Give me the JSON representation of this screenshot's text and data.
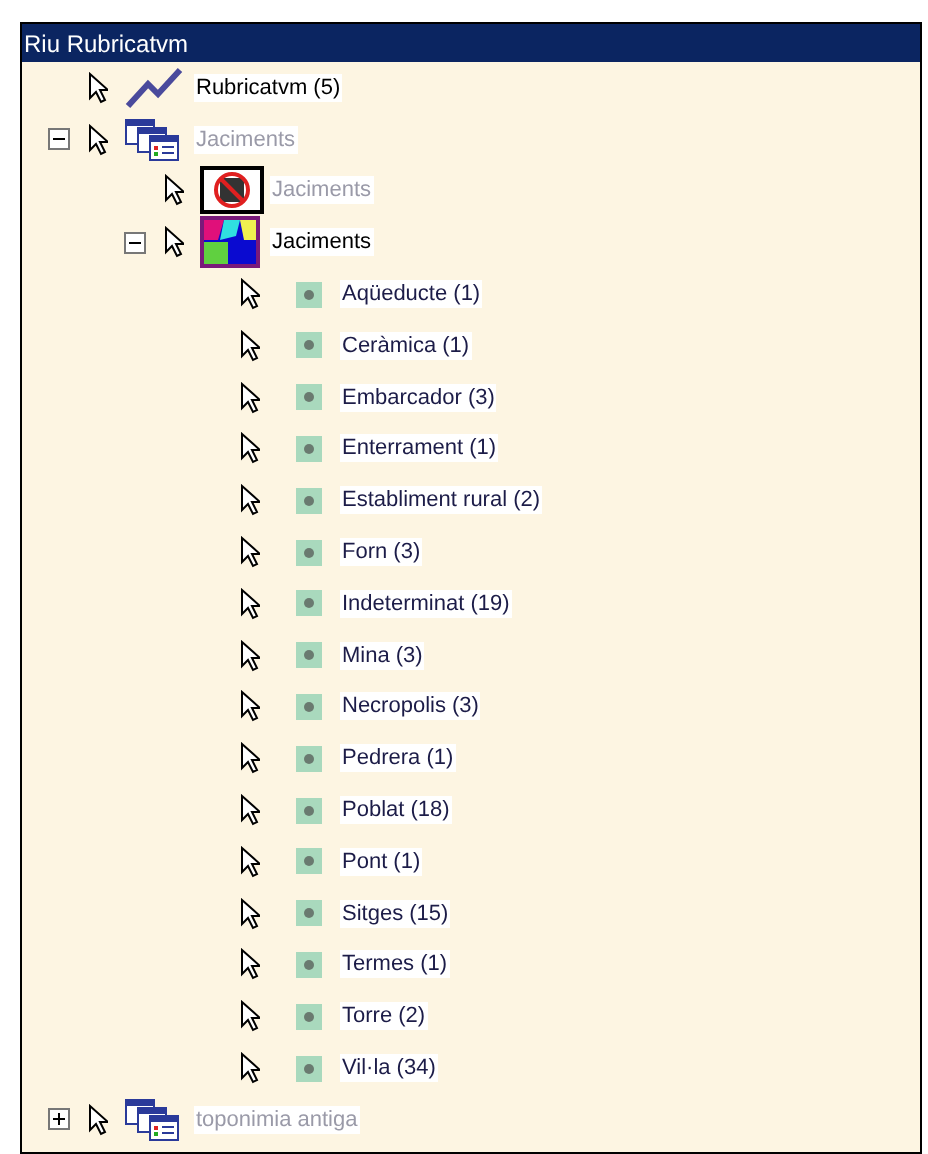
{
  "window": {
    "title": "Riu Rubricatvm"
  },
  "tree": [
    {
      "label": "Rubricatvm (5)",
      "kind": "line",
      "dimmed": false
    },
    {
      "label": "Jaciments",
      "kind": "group",
      "dimmed": true,
      "expanded": true,
      "children": [
        {
          "label": "Jaciments",
          "kind": "disabled-layer",
          "dimmed": true
        },
        {
          "label": "Jaciments",
          "kind": "polygons",
          "dimmed": false,
          "expanded": true,
          "children": [
            {
              "label": "Aqüeducte (1)",
              "kind": "symbol",
              "dimmed": false
            },
            {
              "label": "Ceràmica (1)",
              "kind": "symbol",
              "dimmed": false
            },
            {
              "label": "Embarcador (3)",
              "kind": "symbol",
              "dimmed": false
            },
            {
              "label": "Enterrament (1)",
              "kind": "symbol",
              "dimmed": false
            },
            {
              "label": "Establiment rural (2)",
              "kind": "symbol",
              "dimmed": false
            },
            {
              "label": "Forn (3)",
              "kind": "symbol",
              "dimmed": false
            },
            {
              "label": "Indeterminat (19)",
              "kind": "symbol",
              "dimmed": false
            },
            {
              "label": "Mina (3)",
              "kind": "symbol",
              "dimmed": false
            },
            {
              "label": "Necropolis (3)",
              "kind": "symbol",
              "dimmed": false
            },
            {
              "label": "Pedrera (1)",
              "kind": "symbol",
              "dimmed": false
            },
            {
              "label": "Poblat (18)",
              "kind": "symbol",
              "dimmed": false
            },
            {
              "label": "Pont (1)",
              "kind": "symbol",
              "dimmed": false
            },
            {
              "label": "Sitges (15)",
              "kind": "symbol",
              "dimmed": false
            },
            {
              "label": "Termes (1)",
              "kind": "symbol",
              "dimmed": false
            },
            {
              "label": "Torre (2)",
              "kind": "symbol",
              "dimmed": false
            },
            {
              "label": "Vil·la (34)",
              "kind": "symbol",
              "dimmed": false
            }
          ]
        }
      ]
    },
    {
      "label": "toponimia antiga",
      "kind": "group",
      "dimmed": true,
      "expanded": false
    }
  ]
}
